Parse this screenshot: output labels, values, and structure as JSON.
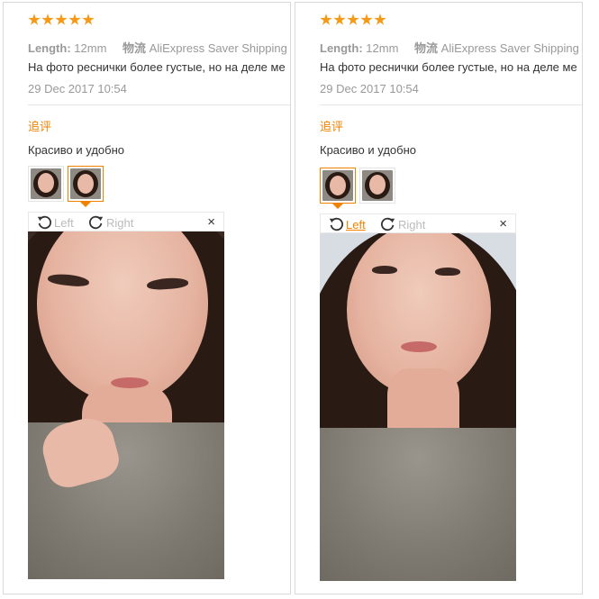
{
  "reviews": [
    {
      "rating": 5,
      "length_label": "Length:",
      "length_value": "12mm",
      "shipping_label": "物流",
      "shipping_value": "AliExpress Saver Shipping",
      "text": "На фото реснички более густые, но на деле ме",
      "date": "29 Dec 2017 10:54",
      "followup_title": "追评",
      "followup_text": "Красиво и удобно",
      "active_thumb": 2,
      "rotate_left_label": "Left",
      "rotate_right_label": "Right",
      "rotate_left_active": false,
      "close_symbol": "×"
    },
    {
      "rating": 5,
      "length_label": "Length:",
      "length_value": "12mm",
      "shipping_label": "物流",
      "shipping_value": "AliExpress Saver Shipping",
      "text": "На фото реснички более густые, но на деле ме",
      "date": "29 Dec 2017 10:54",
      "followup_title": "追评",
      "followup_text": "Красиво и удобно",
      "active_thumb": 1,
      "rotate_left_label": "Left",
      "rotate_right_label": "Right",
      "rotate_left_active": true,
      "close_symbol": "×"
    }
  ],
  "colors": {
    "accent": "#f08200",
    "star": "#f59a18",
    "muted_text": "#999999",
    "body_text": "#333333"
  }
}
